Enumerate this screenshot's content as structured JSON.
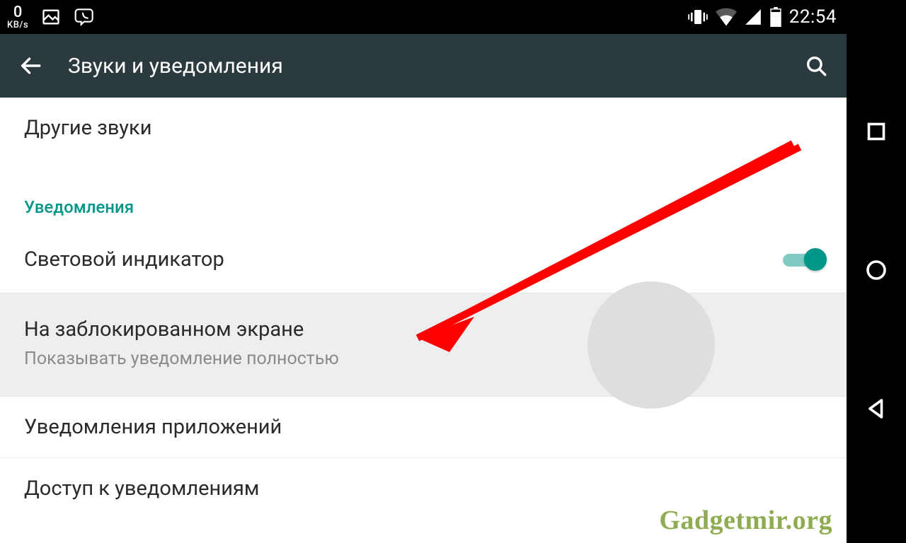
{
  "status": {
    "kbs_value": "0",
    "kbs_unit": "KB/s",
    "time": "22:54"
  },
  "appbar": {
    "title": "Звуки и уведомления"
  },
  "list": {
    "other_sounds": "Другие звуки",
    "section_notifications": "Уведомления",
    "light_indicator": "Световой индикатор",
    "lock_screen_title": "На заблокированном экране",
    "lock_screen_sub": "Показывать уведомление полностью",
    "app_notifications": "Уведомления приложений",
    "notification_access": "Доступ к уведомлениям"
  },
  "watermark": "Gadgetmir.org"
}
